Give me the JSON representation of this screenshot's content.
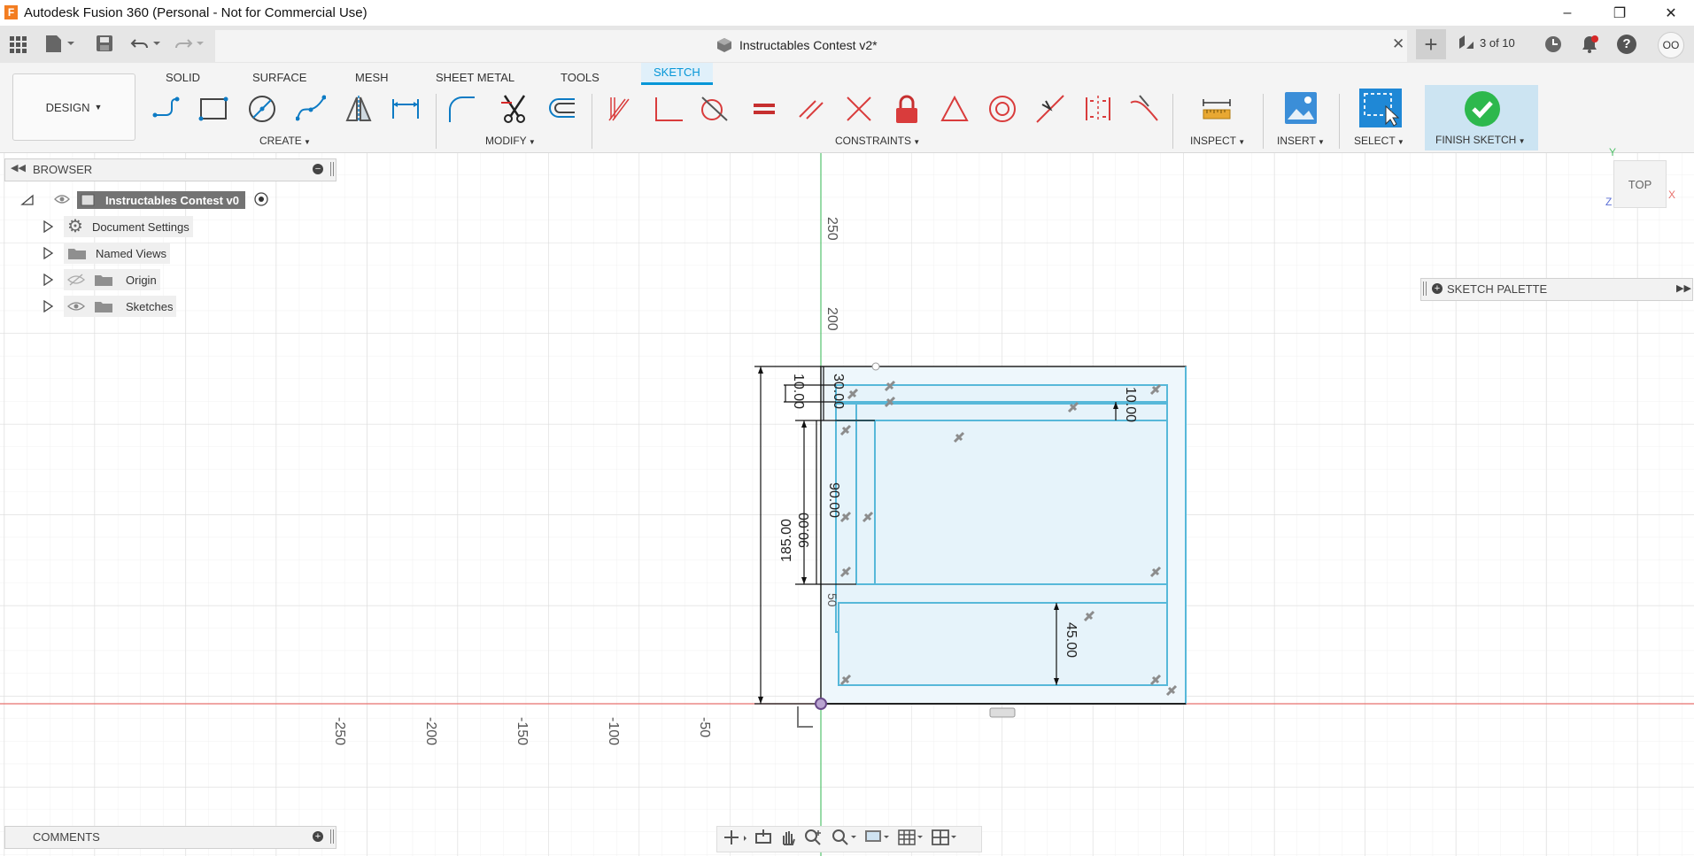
{
  "window": {
    "title": "Autodesk Fusion 360 (Personal - Not for Commercial Use)",
    "app_icon": "F"
  },
  "document": {
    "tab_title": "Instructables Contest v2*",
    "jobs_label": "3 of 10",
    "user_initials": "OO"
  },
  "workspace": {
    "label": "DESIGN"
  },
  "ribbon": {
    "tabs": [
      "SOLID",
      "SURFACE",
      "MESH",
      "SHEET METAL",
      "TOOLS",
      "SKETCH"
    ],
    "active_tab": "SKETCH",
    "groups": {
      "create": "CREATE",
      "modify": "MODIFY",
      "constraints": "CONSTRAINTS",
      "inspect": "INSPECT",
      "insert": "INSERT",
      "select": "SELECT",
      "finish": "FINISH SKETCH"
    }
  },
  "browser": {
    "header": "BROWSER",
    "root": "Instructables Contest v0",
    "items": [
      "Document Settings",
      "Named Views",
      "Origin",
      "Sketches"
    ]
  },
  "comments": {
    "header": "COMMENTS"
  },
  "sketch_palette": {
    "header": "SKETCH PALETTE"
  },
  "viewcube": {
    "face": "TOP",
    "x": "X",
    "y": "Y",
    "z": "Z"
  },
  "axis_labels": {
    "x_ticks": [
      "-250",
      "-200",
      "-150",
      "-100",
      "-50"
    ],
    "y_ticks": [
      "250",
      "200",
      "50"
    ]
  },
  "dimensions": [
    "10.00",
    "30.00",
    "10.00",
    "90.00",
    "90.00",
    "185.00",
    "45.00"
  ],
  "colors": {
    "accent": "#0696d7",
    "sketch_line": "#57b8d9",
    "x_axis": "#e8716d",
    "y_axis": "#54c26d",
    "finish_green": "#2db84d"
  }
}
